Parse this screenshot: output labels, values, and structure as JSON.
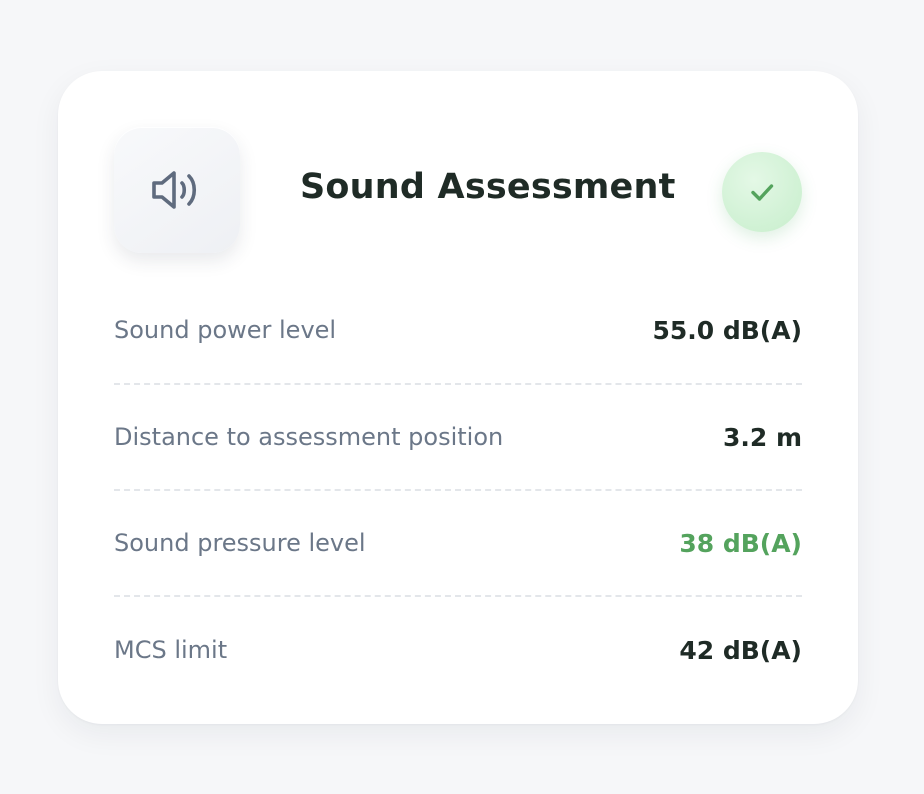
{
  "card": {
    "title": "Sound Assessment",
    "icon": "speaker-volume-icon",
    "status_icon": "check-icon",
    "status_color": "#54a35d"
  },
  "rows": [
    {
      "label": "Sound power level",
      "value": "55.0 dB(A)",
      "highlight": false
    },
    {
      "label": "Distance to assessment position",
      "value": "3.2 m",
      "highlight": false
    },
    {
      "label": "Sound pressure level",
      "value": "38 dB(A)",
      "highlight": true
    },
    {
      "label": "MCS limit",
      "value": "42 dB(A)",
      "highlight": false
    }
  ],
  "colors": {
    "background": "#f6f7f9",
    "card": "#ffffff",
    "title": "#1f2b26",
    "label": "#6b7788",
    "value": "#1f2b26",
    "good": "#54a35d",
    "check_bg": "#d2f2d6"
  }
}
